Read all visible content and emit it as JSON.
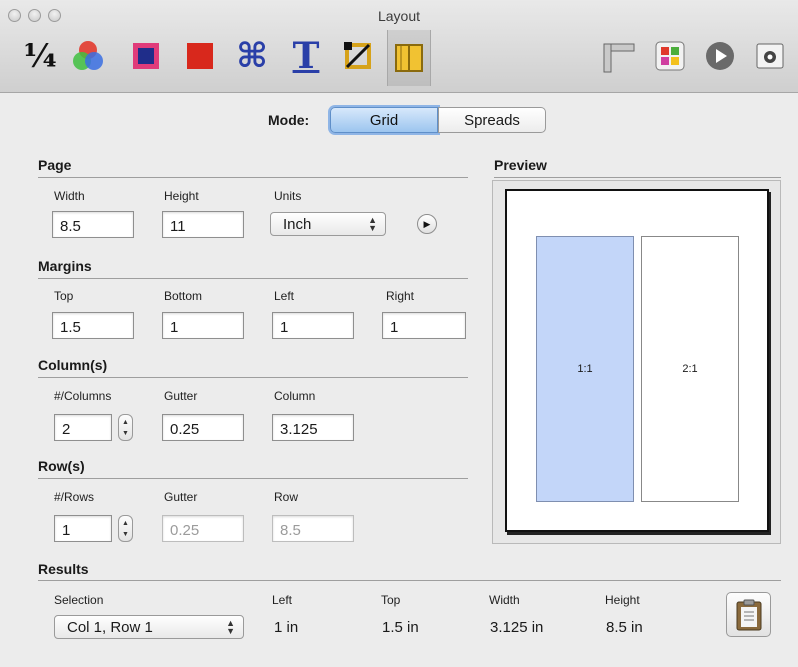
{
  "window": {
    "title": "Layout"
  },
  "toolbar": {
    "fraction_label": "¼",
    "cmd_glyph": "⌘",
    "type_glyph": "T",
    "items": [
      "fraction-icon",
      "color-wheel-icon",
      "layer-color-icon",
      "fill-color-icon",
      "command-icon",
      "text-icon",
      "crop-icon",
      "layout-icon",
      "ruler-icon",
      "palette-icon",
      "play-icon",
      "snapshot-icon"
    ]
  },
  "mode": {
    "label": "Mode:",
    "options": [
      "Grid",
      "Spreads"
    ],
    "selected": "Grid"
  },
  "page": {
    "header": "Page",
    "width_label": "Width",
    "width_value": "8.5",
    "height_label": "Height",
    "height_value": "11",
    "units_label": "Units",
    "units_value": "Inch"
  },
  "margins": {
    "header": "Margins",
    "top_label": "Top",
    "top_value": "1.5",
    "bottom_label": "Bottom",
    "bottom_value": "1",
    "left_label": "Left",
    "left_value": "1",
    "right_label": "Right",
    "right_value": "1"
  },
  "columns": {
    "header": "Column(s)",
    "count_label": "#/Columns",
    "count_value": "2",
    "gutter_label": "Gutter",
    "gutter_value": "0.25",
    "column_label": "Column",
    "column_value": "3.125"
  },
  "rows": {
    "header": "Row(s)",
    "count_label": "#/Rows",
    "count_value": "1",
    "gutter_label": "Gutter",
    "gutter_value": "0.25",
    "row_label": "Row",
    "row_value": "8.5"
  },
  "preview": {
    "header": "Preview",
    "cells": [
      "1:1",
      "2:1"
    ],
    "selected_cell": "1:1"
  },
  "results": {
    "header": "Results",
    "selection_label": "Selection",
    "selection_value": "Col 1, Row 1",
    "left_label": "Left",
    "left_value": "1 in",
    "top_label": "Top",
    "top_value": "1.5 in",
    "width_label": "Width",
    "width_value": "3.125 in",
    "height_label": "Height",
    "height_value": "8.5 in"
  },
  "colors": {
    "accent": "#9cc5ef",
    "selected_cell": "#c3d6f9"
  }
}
